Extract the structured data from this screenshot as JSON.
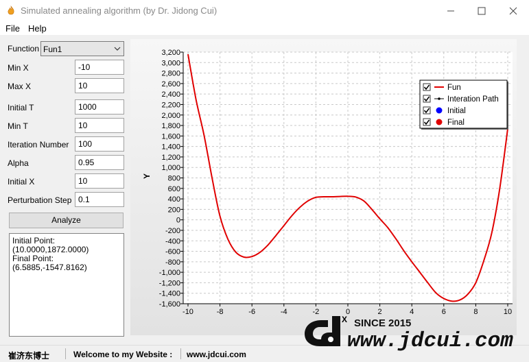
{
  "window": {
    "title": "Simulated annealing algorithm (by Dr. Jidong Cui)",
    "app_icon": "flame-icon"
  },
  "menu": {
    "file": "File",
    "help": "Help"
  },
  "form": {
    "function_label": "Function",
    "function_value": "Fun1",
    "min_x_label": "Min X",
    "min_x": "-10",
    "max_x_label": "Max X",
    "max_x": "10",
    "initial_t_label": "Initial T",
    "initial_t": "1000",
    "min_t_label": "Min T",
    "min_t": "10",
    "iteration_label": "Iteration Number",
    "iteration": "100",
    "alpha_label": "Alpha",
    "alpha": "0.95",
    "initial_x_label": "Initial X",
    "initial_x": "10",
    "perturbation_label": "Perturbation Step",
    "perturbation": "0.1",
    "analyze_label": "Analyze"
  },
  "output": {
    "initial_label": "Initial Point:",
    "initial_value": "(10.0000,1872.0000)",
    "final_label": "Final Point:",
    "final_value": "(6.5885,-1547.8162)"
  },
  "chart_data": {
    "type": "line",
    "xlabel": "X",
    "ylabel": "Y",
    "xlim": [
      -10.3,
      10.3
    ],
    "ylim": [
      -1600,
      3200
    ],
    "xticks": [
      -10,
      -8,
      -6,
      -4,
      -2,
      0,
      2,
      4,
      6,
      8,
      10
    ],
    "xtick_labels": [
      "-10",
      "-8",
      "-6",
      "-4",
      "-2",
      "0",
      "2",
      "4",
      "6",
      "8",
      "10"
    ],
    "yticks": [
      -1600,
      -1400,
      -1200,
      -1000,
      -800,
      -600,
      -400,
      -200,
      0,
      200,
      400,
      600,
      800,
      1000,
      1200,
      1400,
      1600,
      1800,
      2000,
      2200,
      2400,
      2600,
      2800,
      3000,
      3200
    ],
    "ytick_labels": [
      "-1,600",
      "-1,400",
      "-1,200",
      "-1,000",
      "-800",
      "-600",
      "-400",
      "-200",
      "0",
      "200",
      "400",
      "600",
      "800",
      "1,000",
      "1,200",
      "1,400",
      "1,600",
      "1,800",
      "2,000",
      "2,200",
      "2,400",
      "2,600",
      "2,800",
      "3,000",
      "3,200"
    ],
    "grid": true,
    "legend_position": "top-right",
    "series": [
      {
        "name": "Fun",
        "color": "#e00000",
        "x": [
          -10,
          -9.5,
          -9,
          -8.5,
          -8,
          -7.5,
          -7,
          -6.5,
          -6,
          -5.5,
          -5,
          -4.5,
          -4,
          -3.5,
          -3,
          -2.5,
          -2,
          -1.5,
          -1,
          -0.5,
          0,
          0.5,
          1,
          1.5,
          2,
          2.5,
          3,
          3.5,
          4,
          4.5,
          5,
          5.5,
          6,
          6.5,
          7,
          7.5,
          8,
          8.5,
          9,
          9.5,
          10
        ],
        "y": [
          3160,
          2300,
          1620,
          810,
          70,
          -370,
          -620,
          -710,
          -700,
          -620,
          -480,
          -300,
          -110,
          80,
          240,
          360,
          430,
          440,
          440,
          445,
          450,
          435,
          360,
          200,
          20,
          -150,
          -360,
          -590,
          -800,
          -1000,
          -1200,
          -1390,
          -1500,
          -1550,
          -1530,
          -1420,
          -1200,
          -780,
          -250,
          600,
          1740
        ]
      }
    ],
    "legend": [
      {
        "label": "Fun",
        "color": "#e00000",
        "marker": "line"
      },
      {
        "label": "Interation Path",
        "color": "#000000",
        "marker": "dotted-line"
      },
      {
        "label": "Initial",
        "color": "#0000ff",
        "marker": "circle"
      },
      {
        "label": "Final",
        "color": "#e00000",
        "marker": "circle"
      }
    ]
  },
  "status": {
    "name": "崔济东博士",
    "welcome": "Welcome to my Website :",
    "website": "www.jdcui.com"
  },
  "watermark": {
    "since": "SINCE 2015",
    "url": "www.jdcui.com"
  }
}
